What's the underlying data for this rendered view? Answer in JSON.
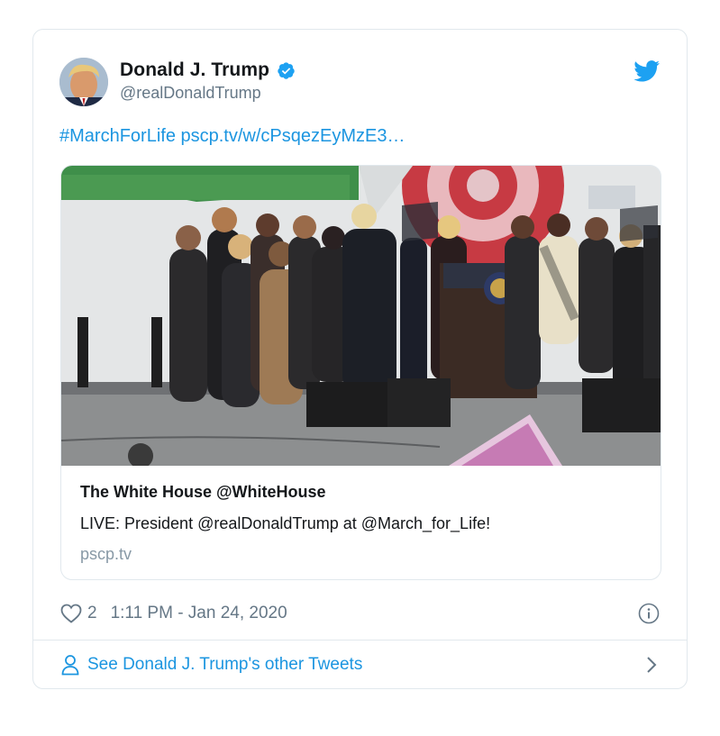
{
  "author": {
    "name": "Donald J. Trump",
    "handle": "@realDonaldTrump"
  },
  "tweet": {
    "hashtag": "#MarchForLife",
    "link": "pscp.tv/w/cPsqezEyMzE3…"
  },
  "link_card": {
    "title": "The White House @WhiteHouse",
    "description": "LIVE: President @realDonaldTrump at @March_for_Life!",
    "domain": "pscp.tv"
  },
  "meta": {
    "likes": "2",
    "timestamp": "1:11 PM - Jan 24, 2020"
  },
  "footer": {
    "link_text": "See Donald J. Trump's other Tweets"
  },
  "icons": {
    "brand": "twitter-bird-icon",
    "verified": "verified-badge-icon",
    "like": "heart-icon",
    "info": "info-icon",
    "profile": "person-icon",
    "more": "chevron-right-icon"
  },
  "colors": {
    "link_blue": "#1b95e0",
    "twitter_blue": "#1da1f2",
    "text_dark": "#14171a",
    "text_gray": "#657786",
    "border": "#e1e8ed"
  }
}
